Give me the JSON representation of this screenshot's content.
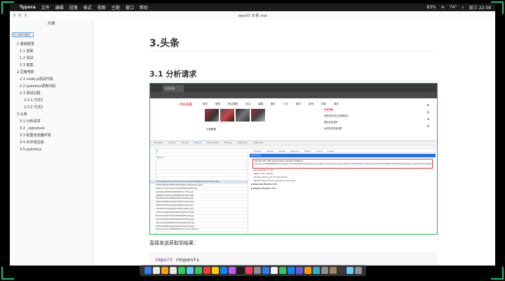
{
  "menubar": {
    "apple_icon": "apple-icon",
    "items": [
      "Typora",
      "文件",
      "编辑",
      "段落",
      "格式",
      "视图",
      "主题",
      "窗口",
      "帮助"
    ],
    "status": [
      "83%",
      "74°",
      "周三 22:58"
    ]
  },
  "window": {
    "title": "day03 头条.md"
  },
  "sidebar": {
    "title": "大纲",
    "search_placeholder": "在大纲中查找",
    "outline": [
      {
        "label": "1.基础登录",
        "level": 1
      },
      {
        "label": "1.1 基础",
        "level": 2
      },
      {
        "label": "1.2 调试",
        "level": 2
      },
      {
        "label": "1.3 答案",
        "level": 2
      },
      {
        "label": "2.豆瓣电影",
        "level": 1
      },
      {
        "label": "2.1 node.js调试代码",
        "level": 2
      },
      {
        "label": "2.2 pyexecjs调用代码",
        "level": 2
      },
      {
        "label": "2.3 调试过程",
        "level": 2
      },
      {
        "label": "2.3.1 方式1",
        "level": 3
      },
      {
        "label": "2.3.2 方式2",
        "level": 3
      },
      {
        "label": "3.头条",
        "level": 1
      },
      {
        "label": "3.1 分析请求",
        "level": 2
      },
      {
        "label": "3.2 _signature",
        "level": 2
      },
      {
        "label": "3.3 配置浏览器环境",
        "level": 2
      },
      {
        "label": "3.4 补环境总结",
        "level": 2
      },
      {
        "label": "3.5 pyexecjs",
        "level": 2
      }
    ]
  },
  "content": {
    "h1": "3.头条",
    "h2": "3.1 分析请求",
    "paragraph": "直接发送获取到结果：",
    "code_lines": [
      {
        "kw": "import",
        "rest": " requests"
      },
      {
        "kw": "",
        "rest": ""
      },
      {
        "kw": "",
        "rest": "res = requests.get("
      }
    ]
  },
  "embed": {
    "tab_label": "今日头条",
    "site_logo": "今日头条",
    "nav": [
      "首页",
      "推荐",
      "西瓜视频",
      "热点",
      "直播",
      "图片",
      "科技",
      "娱乐",
      "游戏",
      "体育",
      "更多"
    ],
    "nav_active": "科技",
    "news_author": "头条新闻",
    "side_items": [
      "头条热榜",
      "黄致列失恋后又悲痛发文",
      "国足男足选举",
      "台湾防务学者前瞻"
    ],
    "devtools_tabs": [
      "Elements",
      "Console",
      "Sources",
      "Network",
      "Performance",
      "Memory",
      "Application",
      "Lighthouse"
    ],
    "devtools_active": "Network",
    "requests": [
      "all",
      "x",
      "?wid=12",
      "x",
      "x",
      "x",
      "x",
      "x",
      "x",
      "info?category=pc_profile_recommend&aid=24&app_name=toutiao_web",
      "l1DPpnf/KRjVBcWXtKnpRVnDMPkAmYEVJrFeapeV.jpeg",
      "b0c97a5c-bbbb-4d10-b2a6-f0bb9ea5b38a.jpeg",
      "ab4a6ee1a4f4a8fad36a9e0fdc2dc78e.jpeg",
      "aab69f0c7d3a4b22ab8e8f6f0e3c8da8.jpeg",
      "1f6a3f3e5d2b4d5a8f7a8d3c2b1a0f9e.jpeg",
      "b6d2c6bb95f04aa4b3bc2f8d7c1e4e21.jpeg",
      "3f6b4b7f1f3a45c4a6b2d4f9e8a7c6d5.jpeg",
      "c9e3a5f7b2d14e6a8f0c7b3d5e1a2f4c.jpeg",
      "e1d2c3b4a5f64e7d8c9b0a1f2e3d4c5b.jpeg",
      "8b7a6c5d4e3f42a1b0c9d8e7f6a5b4c3.jpeg",
      "5d4c3b2a1f0e4d9c8b7a6f5e4d3c2b1a.jpeg",
      "f0e1d2c3b4a54968a7b6c5d4e3f2a1b0.jpeg",
      "a1b2c3d4e5f64a7b8c9d0e1f2a3b4c5d.jpeg",
      "feed?channel=3189398957&max_behot_time=0",
      "x"
    ],
    "detail_tabs": [
      "Headers",
      "Payload",
      "Preview",
      "Response",
      "Initiator",
      "Timing",
      "Cookies"
    ],
    "general_label": "▼ General",
    "request_url": "Request URL: https://www.toutiao.com/api/pc/list/feed?channel_id=3189398957&max_behot_time=0&offset=0&category=pc_profile_channel&client_extra_params=%7B%22short_video_item%22%3A%22filter%22%7D&aid=24&app_name=toutiao_web&msToken=...&a_bogus=...&_signature=...",
    "kv": [
      "Request Method: GET",
      "Status Code: 200 OK",
      "Remote Address: 61.170.101.89:443",
      "Referrer Policy: strict-origin-when-cross-origin"
    ],
    "sections": [
      "▶ Response Headers (13)",
      "▶ Request Headers (19)"
    ]
  },
  "dock": {
    "count": 26
  },
  "colors": {
    "accent_green": "#19c37d",
    "toutiao_red": "#f04142",
    "devtools_blue": "#1a73e8"
  }
}
